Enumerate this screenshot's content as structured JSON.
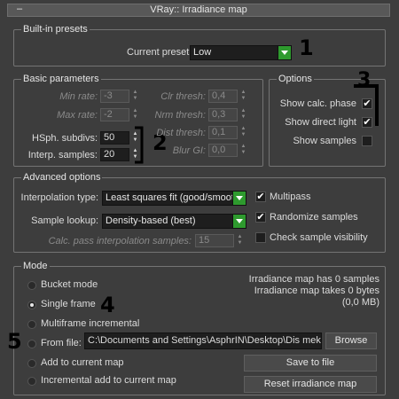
{
  "window": {
    "title": "VRay:: Irradiance map",
    "collapse": "–"
  },
  "builtin": {
    "title": "Built-in presets",
    "preset_label": "Current preset:",
    "preset_value": "Low"
  },
  "basic": {
    "title": "Basic parameters",
    "min_rate_label": "Min rate:",
    "min_rate": "-3",
    "max_rate_label": "Max rate:",
    "max_rate": "-2",
    "hsph_label": "HSph. subdivs:",
    "hsph": "50",
    "interp_label": "Interp. samples:",
    "interp": "20",
    "clr_label": "Clr thresh:",
    "clr": "0,4",
    "nrm_label": "Nrm thresh:",
    "nrm": "0,3",
    "dist_label": "Dist thresh:",
    "dist": "0,1",
    "blur_label": "Blur GI:",
    "blur": "0,0"
  },
  "options": {
    "title": "Options",
    "show_calc": "Show calc. phase",
    "show_direct": "Show direct light",
    "show_samples": "Show samples",
    "check_mark": "✔"
  },
  "advanced": {
    "title": "Advanced options",
    "interp_type_label": "Interpolation type:",
    "interp_type": "Least squares fit (good/smooth)",
    "lookup_label": "Sample lookup:",
    "lookup": "Density-based (best)",
    "calc_pass_label": "Calc. pass interpolation samples:",
    "calc_pass": "15",
    "multipass": "Multipass",
    "randomize": "Randomize samples",
    "check_visibility": "Check sample visibility"
  },
  "mode": {
    "title": "Mode",
    "bucket": "Bucket mode",
    "single": "Single frame",
    "multiframe": "Multiframe incremental",
    "from_file": "From file:",
    "add_current": "Add to current map",
    "incremental_add": "Incremental add to current map",
    "file_path": "C:\\Documents and Settings\\AsphrIN\\Desktop\\Dis meka",
    "browse": "Browse",
    "info1": "Irradiance map has 0 samples",
    "info2": "Irradiance map takes 0 bytes",
    "info3": "(0,0 MB)",
    "save": "Save to file",
    "reset": "Reset irradiance map"
  },
  "annotations": {
    "n1": "1",
    "n2": "2",
    "n3": "3",
    "n4": "4",
    "n5": "5"
  }
}
